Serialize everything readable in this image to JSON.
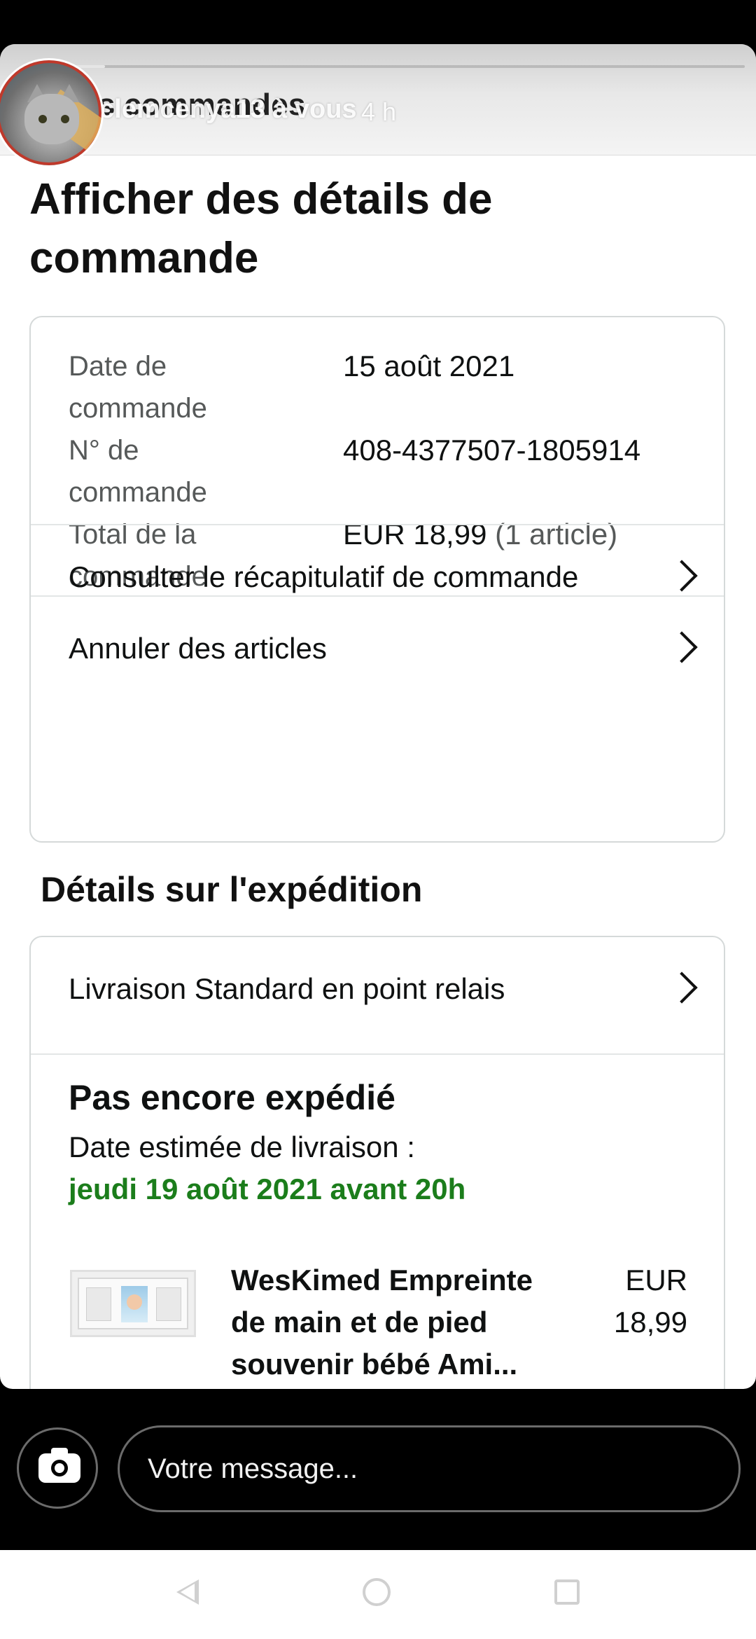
{
  "story": {
    "behind_title": "s commandes",
    "username": "clemcenya13 à vous",
    "time": "4 h"
  },
  "page": {
    "title": "Afficher des détails de commande"
  },
  "order": {
    "date_label": "Date de commande",
    "date_value": "15 août 2021",
    "number_label": "N° de commande",
    "number_value": "408-4377507-1805914",
    "total_label": "Total de la commande",
    "total_value": "EUR 18,99",
    "total_note": "(1 article)"
  },
  "links": {
    "summary": "Consulter le récapitulatif de commande",
    "cancel": "Annuler des articles"
  },
  "shipping": {
    "section_title": "Détails sur l'expédition",
    "method": "Livraison Standard en point relais",
    "status": "Pas encore expédié",
    "eta_label": "Date estimée de livraison :",
    "eta_date": "jeudi 19 août 2021 avant 20h",
    "eta_color": "#1b7d1b"
  },
  "product": {
    "name": "WesKimed Empreinte de main et de pied souvenir bébé Ami...",
    "price": "EUR 18,99"
  },
  "composer": {
    "placeholder": "Votre message..."
  },
  "icons": {
    "camera": "camera-icon",
    "chevron": "chevron-right-icon",
    "back": "back-triangle-icon",
    "home": "home-circle-icon",
    "recent": "recent-square-icon"
  }
}
